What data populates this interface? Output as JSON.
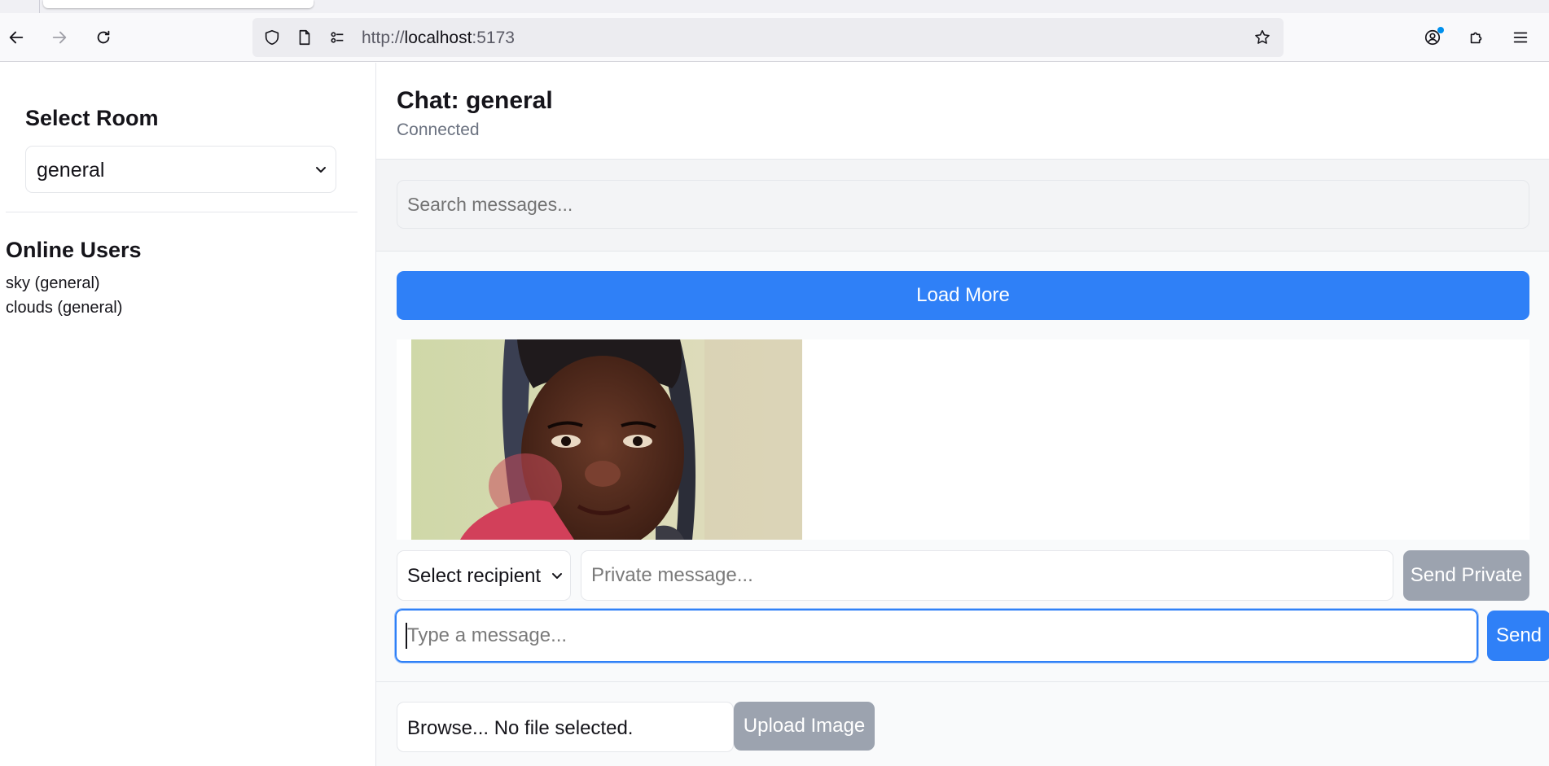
{
  "browser": {
    "url_prefix": "http://",
    "url_host": "localhost",
    "url_port": ":5173"
  },
  "sidebar": {
    "select_room_title": "Select Room",
    "room_selected": "general",
    "online_users_title": "Online Users",
    "online_users": [
      "sky (general)",
      "clouds (general)"
    ]
  },
  "chat": {
    "title": "Chat: general",
    "status": "Connected",
    "search_placeholder": "Search messages...",
    "load_more_label": "Load More",
    "recipient_selected": "Select recipient",
    "private_placeholder": "Private message...",
    "send_private_label": "Send Private",
    "message_placeholder": "Type a message...",
    "send_label": "Send",
    "file_input_text": "Browse... No file selected.",
    "upload_label": "Upload Image"
  },
  "colors": {
    "accent": "#2f80f7",
    "disabled": "#9ca3af",
    "muted_text": "#6b7280"
  }
}
